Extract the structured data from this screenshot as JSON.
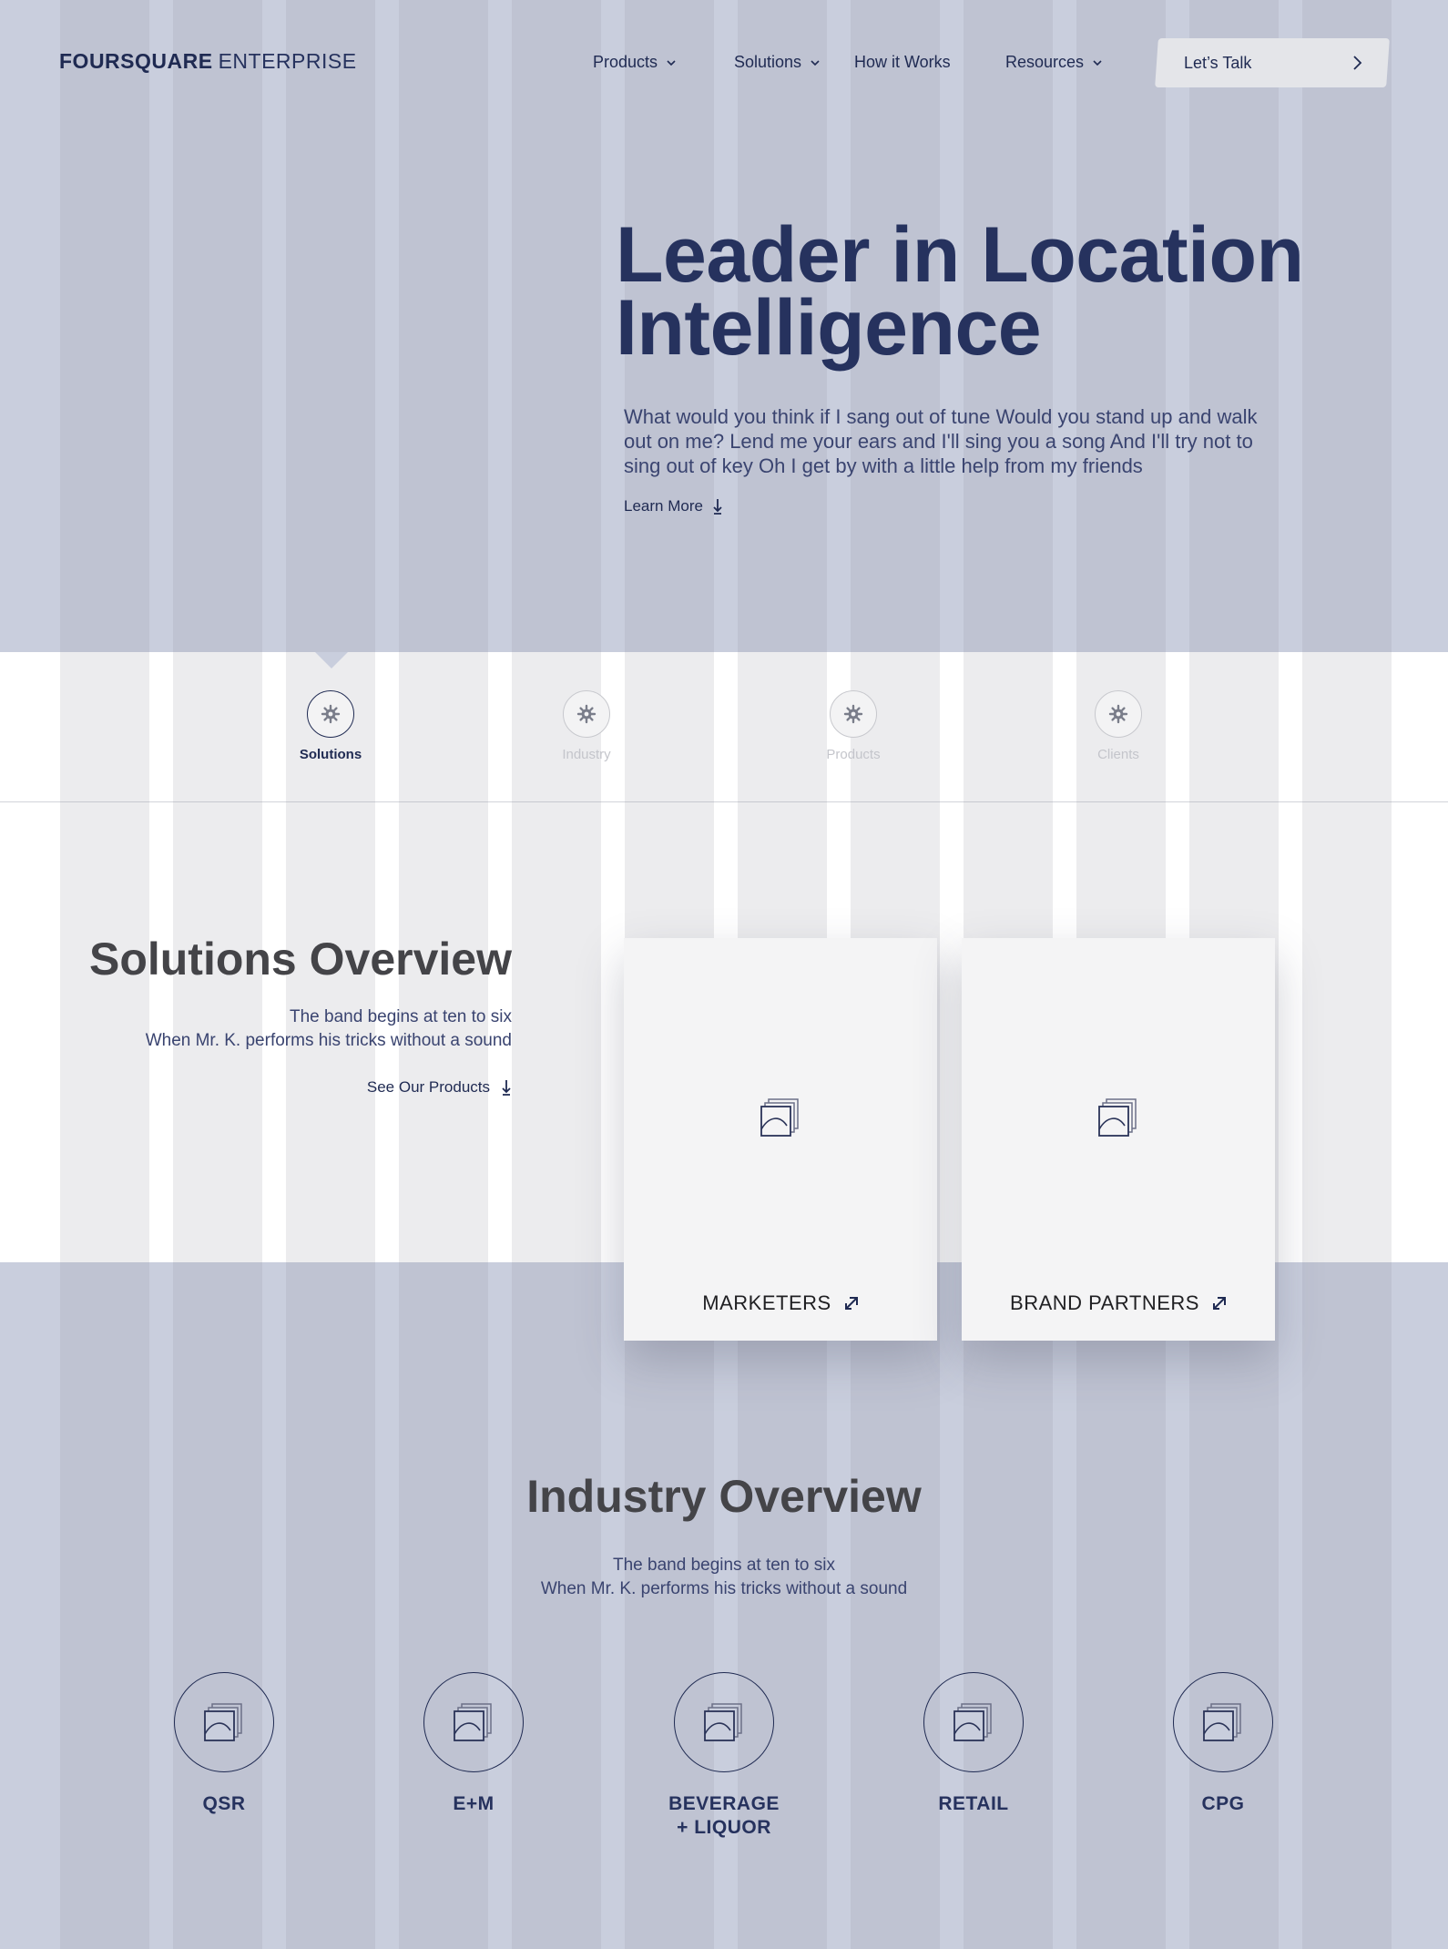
{
  "header": {
    "logo_brand": "FOURSQUARE",
    "logo_sub": "ENTERPRISE",
    "nav": [
      {
        "label": "Products",
        "has_dropdown": true
      },
      {
        "label": "Solutions",
        "has_dropdown": true
      },
      {
        "label": "How it Works",
        "has_dropdown": false
      },
      {
        "label": "Resources",
        "has_dropdown": true
      }
    ],
    "cta_label": "Let’s Talk",
    "cta_icon": "chevron-right-icon"
  },
  "hero": {
    "title_line1": "Leader in Location",
    "title_line2": "Intelligence",
    "body": "What would you think if I sang out of tune Would you stand up and walk out on me? Lend me your ears and I'll sing you a song And I'll try not to sing out of key Oh I get by with a little help from my friends",
    "learn_more": "Learn More",
    "learn_more_icon": "arrow-down-icon"
  },
  "tabs": [
    {
      "label": "Solutions",
      "icon": "gear-icon",
      "active": true
    },
    {
      "label": "Industry",
      "icon": "gear-icon",
      "active": false
    },
    {
      "label": "Products",
      "icon": "gear-icon",
      "active": false
    },
    {
      "label": "Clients",
      "icon": "gear-icon",
      "active": false
    }
  ],
  "solutions": {
    "title": "Solutions Overview",
    "body_line1": "The band begins at ten to six",
    "body_line2": "When Mr. K. performs his tricks without a sound",
    "link": "See Our Products",
    "link_icon": "arrow-down-icon",
    "cards": [
      {
        "label": "MARKETERS",
        "image_icon": "image-placeholder-icon",
        "link_icon": "external-link-icon"
      },
      {
        "label": "BRAND PARTNERS",
        "image_icon": "image-placeholder-icon",
        "link_icon": "external-link-icon"
      }
    ]
  },
  "industry": {
    "title": "Industry Overview",
    "body_line1": "The band begins at ten to six",
    "body_line2": "When Mr. K. performs his tricks without a sound",
    "items": [
      {
        "label_line1": "QSR",
        "label_line2": ""
      },
      {
        "label_line1": "E+M",
        "label_line2": ""
      },
      {
        "label_line1": "BEVERAGE",
        "label_line2": "+ LIQUOR"
      },
      {
        "label_line1": "RETAIL",
        "label_line2": ""
      },
      {
        "label_line1": "CPG",
        "label_line2": ""
      }
    ]
  },
  "colors": {
    "navy": "#1f2a52",
    "hero_bg": "#c9cedd",
    "heading_gray": "#444448",
    "inactive_tab": "#c4c5cb"
  }
}
